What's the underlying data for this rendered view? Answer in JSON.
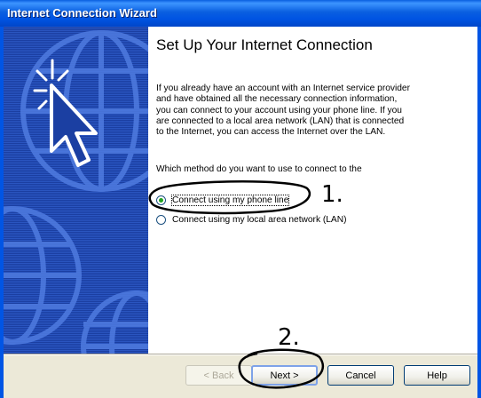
{
  "window": {
    "title": "Internet Connection Wizard"
  },
  "content": {
    "heading": "Set Up Your Internet Connection",
    "description": "If you already have an account with an Internet service provider and have obtained all the necessary connection information, you can connect to your account using your phone line. If you are connected to a local area network (LAN) that is connected to the Internet, you can access the Internet over the LAN.",
    "question": "Which method do you want to use to connect to the",
    "options": [
      {
        "label": "Connect using my phone line",
        "selected": true
      },
      {
        "label": "Connect using my local area network (LAN)",
        "selected": false
      }
    ]
  },
  "buttons": {
    "back": "< Back",
    "next": "Next >",
    "cancel": "Cancel",
    "help": "Help"
  },
  "annotations": {
    "step1": "1.",
    "step2": "2."
  },
  "colors": {
    "titlebar": "#0054E3",
    "side_panel": "#1B3FA2",
    "annotation_ink": "#000000"
  }
}
